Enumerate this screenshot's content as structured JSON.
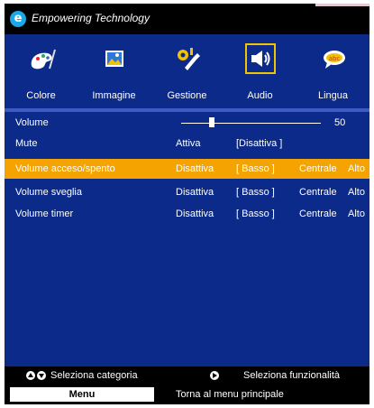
{
  "header": {
    "brand": "Empowering Technology",
    "logo_letter": "e"
  },
  "tabs": [
    {
      "label": "Colore",
      "icon": "palette-icon"
    },
    {
      "label": "Immagine",
      "icon": "picture-icon"
    },
    {
      "label": "Gestione",
      "icon": "tools-icon"
    },
    {
      "label": "Audio",
      "icon": "speaker-icon",
      "selected": true
    },
    {
      "label": "Lingua",
      "icon": "language-bubble-icon"
    }
  ],
  "rows": {
    "volume": {
      "label": "Volume",
      "value": "50",
      "level": 0.5
    },
    "mute": {
      "label": "Mute",
      "opt1": "Attiva",
      "opt2": "[Disattiva ]"
    },
    "vol_onoff": {
      "label": "Volume acceso/spento",
      "opt1": "Disattiva",
      "opt2": "[ Basso ]",
      "opt3": "Centrale",
      "opt4": "Alto"
    },
    "vol_wake": {
      "label": "Volume sveglia",
      "opt1": "Disattiva",
      "opt2": "[ Basso ]",
      "opt3": "Centrale",
      "opt4": "Alto"
    },
    "vol_timer": {
      "label": "Volume timer",
      "opt1": "Disattiva",
      "opt2": "[ Basso ]",
      "opt3": "Centrale",
      "opt4": "Alto"
    }
  },
  "footer": {
    "select_category": "Seleziona categoria",
    "select_function": "Seleziona funzionalità",
    "menu_label": "Menu",
    "back_text": "Torna al menu principale"
  },
  "colors": {
    "osd_bg": "#0b2a8a",
    "highlight": "#f4a300",
    "selection_border": "#f3c300"
  }
}
